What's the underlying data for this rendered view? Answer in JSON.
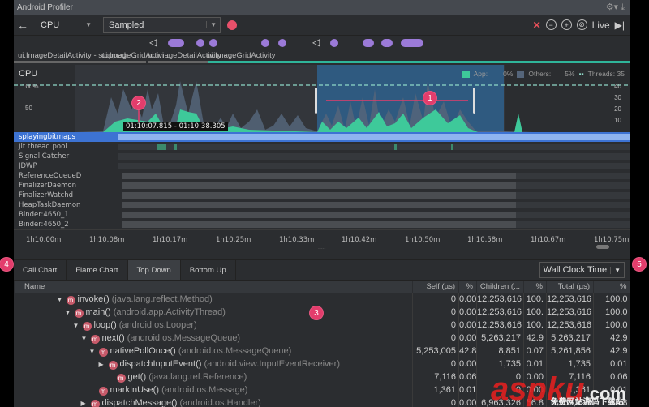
{
  "title": "Android Profiler",
  "toolbar": {
    "monitor": "CPU",
    "mode": "Sampled",
    "live": "Live"
  },
  "activities": [
    "ui.ImageDetailActivity - stopped - ...",
    "ui.ImageGridActivi...",
    "ui.ImageDetailActivity - ...",
    "ui.ImageGridActivity"
  ],
  "cpu": {
    "label": "CPU",
    "y_left": [
      "100%",
      "50"
    ],
    "y_right": [
      "40",
      "30",
      "20",
      "10"
    ],
    "legend": {
      "app_label": "App:",
      "app_value": "0%",
      "others_label": "Others:",
      "others_value": "5%",
      "threads_label": "Threads: 35"
    },
    "range_label": "01:10:07.815 - 01:10:38.305",
    "colors": {
      "app": "#3ec99a",
      "others": "#55657a",
      "selection": "#2f5a80"
    }
  },
  "threads": [
    "splayingbitmaps",
    "Jit thread pool",
    "Signal Catcher",
    "JDWP",
    "ReferenceQueueD",
    "FinalizerDaemon",
    "FinalizerWatchd",
    "HeapTaskDaemon",
    "Binder:4650_1",
    "Binder:4650_2"
  ],
  "axis": [
    "1h10.00m",
    "1h10.08m",
    "1h10.17m",
    "1h10.25m",
    "1h10.33m",
    "1h10.42m",
    "1h10.50m",
    "1h10.58m",
    "1h10.67m",
    "1h10.75m"
  ],
  "tabs": [
    "Call Chart",
    "Flame Chart",
    "Top Down",
    "Bottom Up"
  ],
  "clock": "Wall Clock Time",
  "annotations": [
    "1",
    "2",
    "3",
    "4",
    "5"
  ],
  "table": {
    "headers": [
      "Name",
      "Self (µs)",
      "%",
      "Children (...",
      "%",
      "Total (µs)",
      "%"
    ],
    "rows": [
      {
        "name": "invoke()",
        "pkg": "(java.lang.reflect.Method)",
        "toggle": "▼",
        "cells": [
          "0",
          "0.00",
          "12,253,616",
          "100.",
          "12,253,616",
          "100.0"
        ]
      },
      {
        "name": "main()",
        "pkg": "(android.app.ActivityThread)",
        "toggle": "▼",
        "cells": [
          "0",
          "0.00",
          "12,253,616",
          "100.",
          "12,253,616",
          "100.0"
        ]
      },
      {
        "name": "loop()",
        "pkg": "(android.os.Looper)",
        "toggle": "▼",
        "cells": [
          "0",
          "0.00",
          "12,253,616",
          "100.",
          "12,253,616",
          "100.0"
        ]
      },
      {
        "name": "next()",
        "pkg": "(android.os.MessageQueue)",
        "toggle": "▼",
        "cells": [
          "0",
          "0.00",
          "5,263,217",
          "42.9",
          "5,263,217",
          "42.9"
        ]
      },
      {
        "name": "nativePollOnce()",
        "pkg": "(android.os.MessageQueue)",
        "toggle": "▼",
        "cells": [
          "5,253,005",
          "42.8",
          "8,851",
          "0.07",
          "5,261,856",
          "42.9"
        ]
      },
      {
        "name": "dispatchInputEvent()",
        "pkg": "(android.view.InputEventReceiver)",
        "toggle": "▶",
        "cells": [
          "0",
          "0.00",
          "1,735",
          "0.01",
          "1,735",
          "0.01"
        ]
      },
      {
        "name": "get()",
        "pkg": "(java.lang.ref.Reference)",
        "toggle": "",
        "cells": [
          "7,116",
          "0.06",
          "0",
          "0.00",
          "7,116",
          "0.06"
        ]
      },
      {
        "name": "markInUse()",
        "pkg": "(android.os.Message)",
        "toggle": "",
        "cells": [
          "1,361",
          "0.01",
          "0",
          "0.00",
          "1,361",
          "0.01"
        ]
      },
      {
        "name": "dispatchMessage()",
        "pkg": "(android.os.Handler)",
        "toggle": "▶",
        "cells": [
          "0",
          "0.00",
          "6,963,326",
          "56.8",
          "6,963,326",
          "56.8"
        ]
      }
    ]
  },
  "watermark": {
    "text": "aspku.com",
    "sub": "免费网站源码下载站!"
  }
}
